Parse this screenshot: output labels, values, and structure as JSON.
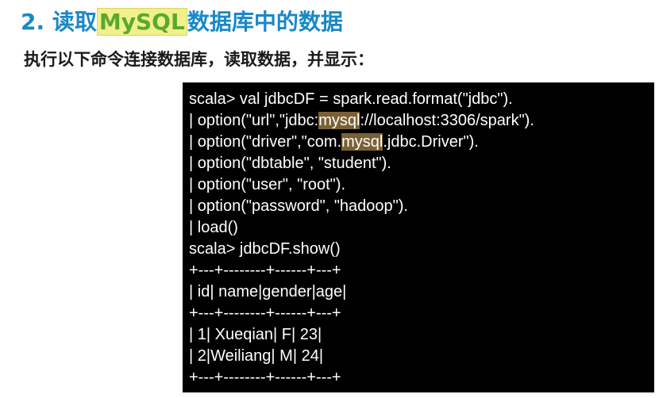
{
  "title": {
    "prefix": "2. 读取",
    "highlight": "MySQL",
    "suffix": "数据库中的数据"
  },
  "subtitle": "执行以下命令连接数据库，读取数据，并显示：",
  "code_block": {
    "lines": [
      {
        "pre": "scala> val jdbcDF = spark.read.format(\"jdbc\")."
      },
      {
        "pre": "| option(\"url\",\"jdbc:",
        "mark": "mysql",
        "post": "://localhost:3306/spark\")."
      },
      {
        "pre": "| option(\"driver\",\"com.",
        "mark": "mysql",
        "post": ".jdbc.Driver\")."
      },
      {
        "pre": "| option(\"dbtable\", \"student\")."
      },
      {
        "pre": "| option(\"user\", \"root\")."
      },
      {
        "pre": "| option(\"password\", \"hadoop\")."
      },
      {
        "pre": "| load()"
      },
      {
        "pre": "scala> jdbcDF.show()"
      },
      {
        "pre": "+---+--------+------+---+"
      },
      {
        "pre": "| id| name|gender|age|"
      },
      {
        "pre": "+---+--------+------+---+"
      },
      {
        "pre": "| 1| Xueqian| F| 23|"
      },
      {
        "pre": "| 2|Weiliang| M| 24|"
      },
      {
        "pre": "+---+--------+------+---+"
      }
    ]
  },
  "colors": {
    "title": "#1a88c6",
    "title_highlight_bg": "#f1f08a",
    "title_highlight_text": "#5aa830",
    "code_bg": "#000000",
    "code_text": "#ffffff",
    "code_mark_bg": "#7a6135"
  }
}
